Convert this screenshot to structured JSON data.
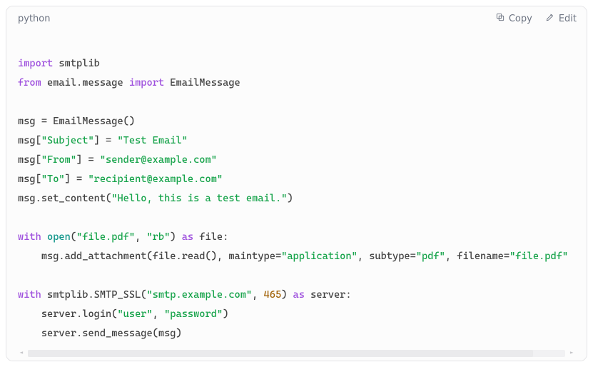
{
  "header": {
    "language": "python",
    "copy_label": "Copy",
    "edit_label": "Edit"
  },
  "code": {
    "lines": [
      [],
      [
        {
          "t": "import",
          "c": "kw"
        },
        {
          "t": " smtplib",
          "c": "id"
        }
      ],
      [
        {
          "t": "from",
          "c": "kw"
        },
        {
          "t": " email.message ",
          "c": "id"
        },
        {
          "t": "import",
          "c": "kw"
        },
        {
          "t": " EmailMessage",
          "c": "id"
        }
      ],
      [],
      [
        {
          "t": "msg = EmailMessage()",
          "c": "id"
        }
      ],
      [
        {
          "t": "msg[",
          "c": "id"
        },
        {
          "t": "\"Subject\"",
          "c": "str"
        },
        {
          "t": "] = ",
          "c": "id"
        },
        {
          "t": "\"Test Email\"",
          "c": "str"
        }
      ],
      [
        {
          "t": "msg[",
          "c": "id"
        },
        {
          "t": "\"From\"",
          "c": "str"
        },
        {
          "t": "] = ",
          "c": "id"
        },
        {
          "t": "\"sender@example.com\"",
          "c": "str"
        }
      ],
      [
        {
          "t": "msg[",
          "c": "id"
        },
        {
          "t": "\"To\"",
          "c": "str"
        },
        {
          "t": "] = ",
          "c": "id"
        },
        {
          "t": "\"recipient@example.com\"",
          "c": "str"
        }
      ],
      [
        {
          "t": "msg.set_content(",
          "c": "id"
        },
        {
          "t": "\"Hello, this is a test email.\"",
          "c": "str"
        },
        {
          "t": ")",
          "c": "id"
        }
      ],
      [],
      [
        {
          "t": "with",
          "c": "kw"
        },
        {
          "t": " ",
          "c": "id"
        },
        {
          "t": "open",
          "c": "fn"
        },
        {
          "t": "(",
          "c": "id"
        },
        {
          "t": "\"file.pdf\"",
          "c": "str"
        },
        {
          "t": ", ",
          "c": "id"
        },
        {
          "t": "\"rb\"",
          "c": "str"
        },
        {
          "t": ") ",
          "c": "id"
        },
        {
          "t": "as",
          "c": "kw"
        },
        {
          "t": " file:",
          "c": "id"
        }
      ],
      [
        {
          "t": "    msg.add_attachment(file.read(), maintype=",
          "c": "id"
        },
        {
          "t": "\"application\"",
          "c": "str"
        },
        {
          "t": ", subtype=",
          "c": "id"
        },
        {
          "t": "\"pdf\"",
          "c": "str"
        },
        {
          "t": ", filename=",
          "c": "id"
        },
        {
          "t": "\"file.pdf\"",
          "c": "str"
        }
      ],
      [],
      [
        {
          "t": "with",
          "c": "kw"
        },
        {
          "t": " smtplib.SMTP_SSL(",
          "c": "id"
        },
        {
          "t": "\"smtp.example.com\"",
          "c": "str"
        },
        {
          "t": ", ",
          "c": "id"
        },
        {
          "t": "465",
          "c": "num"
        },
        {
          "t": ") ",
          "c": "id"
        },
        {
          "t": "as",
          "c": "kw"
        },
        {
          "t": " server:",
          "c": "id"
        }
      ],
      [
        {
          "t": "    server.login(",
          "c": "id"
        },
        {
          "t": "\"user\"",
          "c": "str"
        },
        {
          "t": ", ",
          "c": "id"
        },
        {
          "t": "\"password\"",
          "c": "str"
        },
        {
          "t": ")",
          "c": "id"
        }
      ],
      [
        {
          "t": "    server.send_message(msg)",
          "c": "id"
        }
      ]
    ]
  }
}
